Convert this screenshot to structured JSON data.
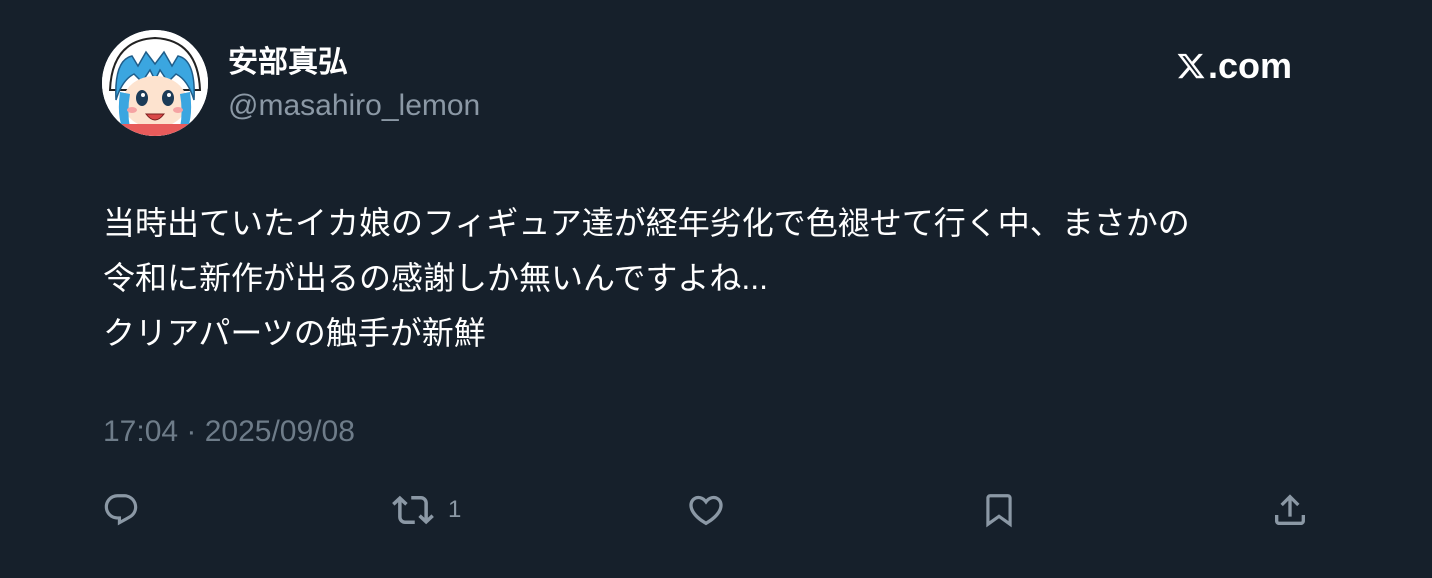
{
  "user": {
    "display_name": "安部真弘",
    "handle": "@masahiro_lemon",
    "avatar_icon": "avatar-cartoon-squid-girl"
  },
  "brand": {
    "site_label": ".com",
    "logo_icon": "x-logo-icon"
  },
  "tweet": {
    "lines": [
      "当時出ていたイカ娘のフィギュア達が経年劣化で色褪せて行く中、まさかの",
      "令和に新作が出るの感謝しか無いんですよね...",
      "クリアパーツの触手が新鮮"
    ],
    "timestamp": "17:04 · 2025/09/08"
  },
  "actions": {
    "reply": {
      "icon": "reply-icon",
      "count": ""
    },
    "retweet": {
      "icon": "retweet-icon",
      "count": "1"
    },
    "like": {
      "icon": "heart-icon",
      "count": ""
    },
    "bookmark": {
      "icon": "bookmark-icon",
      "count": ""
    },
    "share": {
      "icon": "share-icon",
      "count": ""
    }
  },
  "colors": {
    "background": "#16202b",
    "primary_text": "#ffffff",
    "secondary_text": "#8b98a5",
    "icon_color": "#8b98a5"
  }
}
